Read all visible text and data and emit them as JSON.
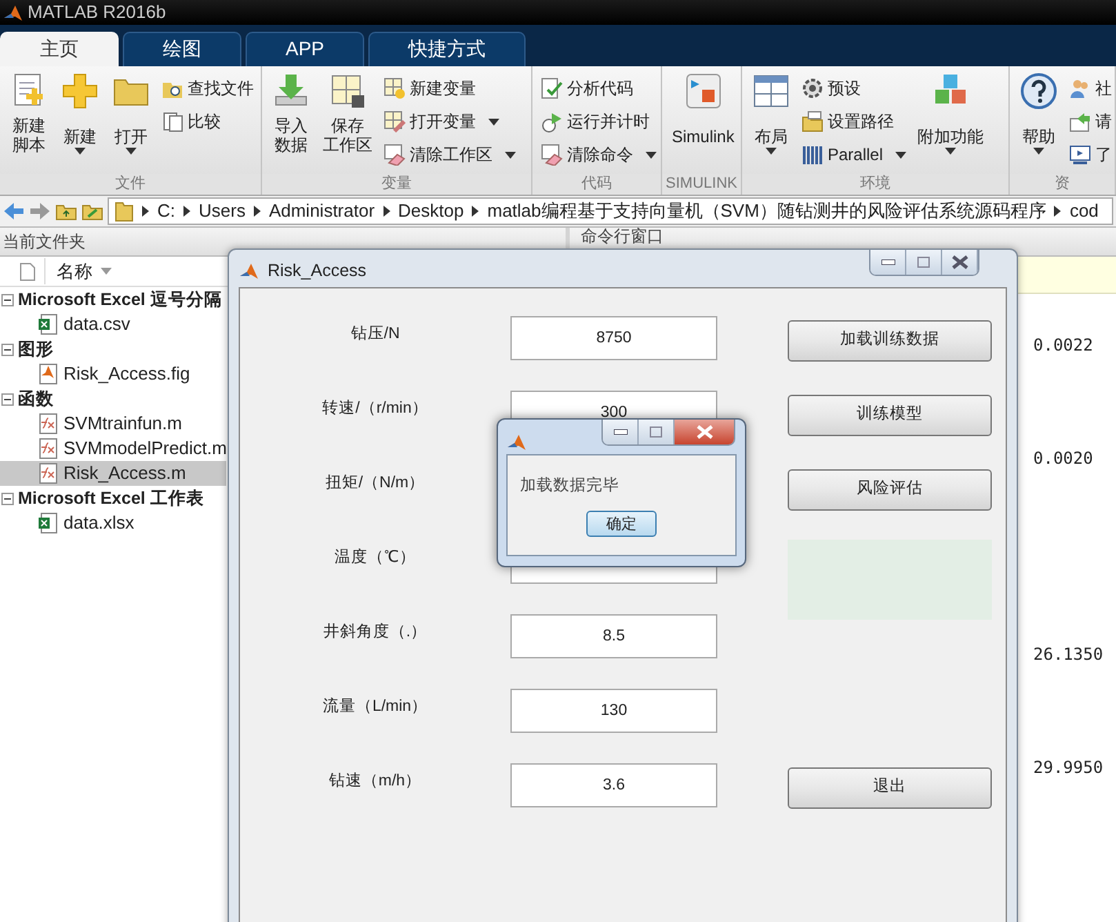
{
  "window": {
    "title": "MATLAB R2016b"
  },
  "tabs": [
    {
      "label": "主页",
      "selected": true
    },
    {
      "label": "绘图",
      "selected": false
    },
    {
      "label": "APP",
      "selected": false
    },
    {
      "label": "快捷方式",
      "selected": false
    }
  ],
  "ribbon": [
    {
      "title": "文件",
      "items": [
        {
          "kind": "large",
          "lines": [
            "新建",
            "脚本"
          ],
          "dropdown": false
        },
        {
          "kind": "large",
          "label": "新建",
          "dropdown": true
        },
        {
          "kind": "large",
          "label": "打开",
          "dropdown": true
        },
        {
          "kind": "stack",
          "entries": [
            {
              "label": "查找文件",
              "dropdown": false
            },
            {
              "label": "比较",
              "dropdown": false
            }
          ]
        }
      ]
    },
    {
      "title": "变量",
      "items": [
        {
          "kind": "large",
          "lines": [
            "导入",
            "数据"
          ],
          "dropdown": false
        },
        {
          "kind": "large",
          "lines": [
            "保存",
            "工作区"
          ],
          "dropdown": false
        },
        {
          "kind": "stack",
          "entries": [
            {
              "label": "新建变量",
              "dropdown": false
            },
            {
              "label": "打开变量",
              "dropdown": true
            },
            {
              "label": "清除工作区",
              "dropdown": true
            }
          ]
        }
      ]
    },
    {
      "title": "代码",
      "items": [
        {
          "kind": "stack",
          "entries": [
            {
              "label": "分析代码",
              "dropdown": false
            },
            {
              "label": "运行并计时",
              "dropdown": false
            },
            {
              "label": "清除命令",
              "dropdown": true
            }
          ]
        }
      ]
    },
    {
      "title": "SIMULINK",
      "items": [
        {
          "kind": "large",
          "label": "Simulink",
          "dropdown": false
        }
      ]
    },
    {
      "title": "环境",
      "items": [
        {
          "kind": "large",
          "label": "布局",
          "dropdown": true
        },
        {
          "kind": "stack",
          "entries": [
            {
              "label": "预设",
              "dropdown": false
            },
            {
              "label": "设置路径",
              "dropdown": false
            },
            {
              "label": "Parallel",
              "dropdown": true
            }
          ]
        },
        {
          "kind": "large",
          "label": "附加功能",
          "dropdown": true
        }
      ]
    },
    {
      "title": "资",
      "items": [
        {
          "kind": "large",
          "label": "帮助",
          "dropdown": true
        },
        {
          "kind": "stack",
          "entries": [
            {
              "label": "社",
              "dropdown": false
            },
            {
              "label": "请",
              "dropdown": false
            },
            {
              "label": "了",
              "dropdown": false
            }
          ]
        }
      ]
    }
  ],
  "path": [
    "C:",
    "Users",
    "Administrator",
    "Desktop",
    "matlab编程基于支持向量机（SVM）随钻测井的风险评估系统源码程序",
    "cod"
  ],
  "folder_panel": {
    "title": "当前文件夹",
    "column": "名称",
    "tree": [
      {
        "label": "Microsoft Excel 逗号分隔",
        "expanded": true,
        "children": [
          {
            "label": "data.csv",
            "kind": "excel",
            "selected": false
          }
        ]
      },
      {
        "label": "图形",
        "expanded": true,
        "children": [
          {
            "label": "Risk_Access.fig",
            "kind": "figure",
            "selected": false
          }
        ]
      },
      {
        "label": "函数",
        "expanded": true,
        "children": [
          {
            "label": "SVMtrainfun.m",
            "kind": "function",
            "selected": false
          },
          {
            "label": "SVMmodelPredict.m",
            "kind": "function",
            "selected": false
          },
          {
            "label": "Risk_Access.m",
            "kind": "function",
            "selected": true
          }
        ]
      },
      {
        "label": "Microsoft Excel 工作表",
        "expanded": true,
        "children": [
          {
            "label": "data.xlsx",
            "kind": "excel",
            "selected": false
          }
        ]
      }
    ]
  },
  "command_window": {
    "title": "命令行窗口",
    "output": [
      "0.0022",
      "0.0020",
      "26.1350",
      "29.9950"
    ]
  },
  "app_window": {
    "title": "Risk_Access",
    "fields": [
      {
        "label": "钻压/N",
        "value": "8750"
      },
      {
        "label": "转速/（r/min）",
        "value": "300"
      },
      {
        "label": "扭矩/（N/m）"
      },
      {
        "label": "温度（℃）"
      },
      {
        "label": "井斜角度（.）",
        "value": "8.5"
      },
      {
        "label": "流量（L/min）",
        "value": "130"
      },
      {
        "label": "钻速（m/h）",
        "value": "3.6"
      }
    ],
    "buttons": [
      "加载训练数据",
      "训练模型",
      "风险评估",
      "退出"
    ]
  },
  "message_box": {
    "message": "加载数据完毕",
    "button": "确定"
  }
}
